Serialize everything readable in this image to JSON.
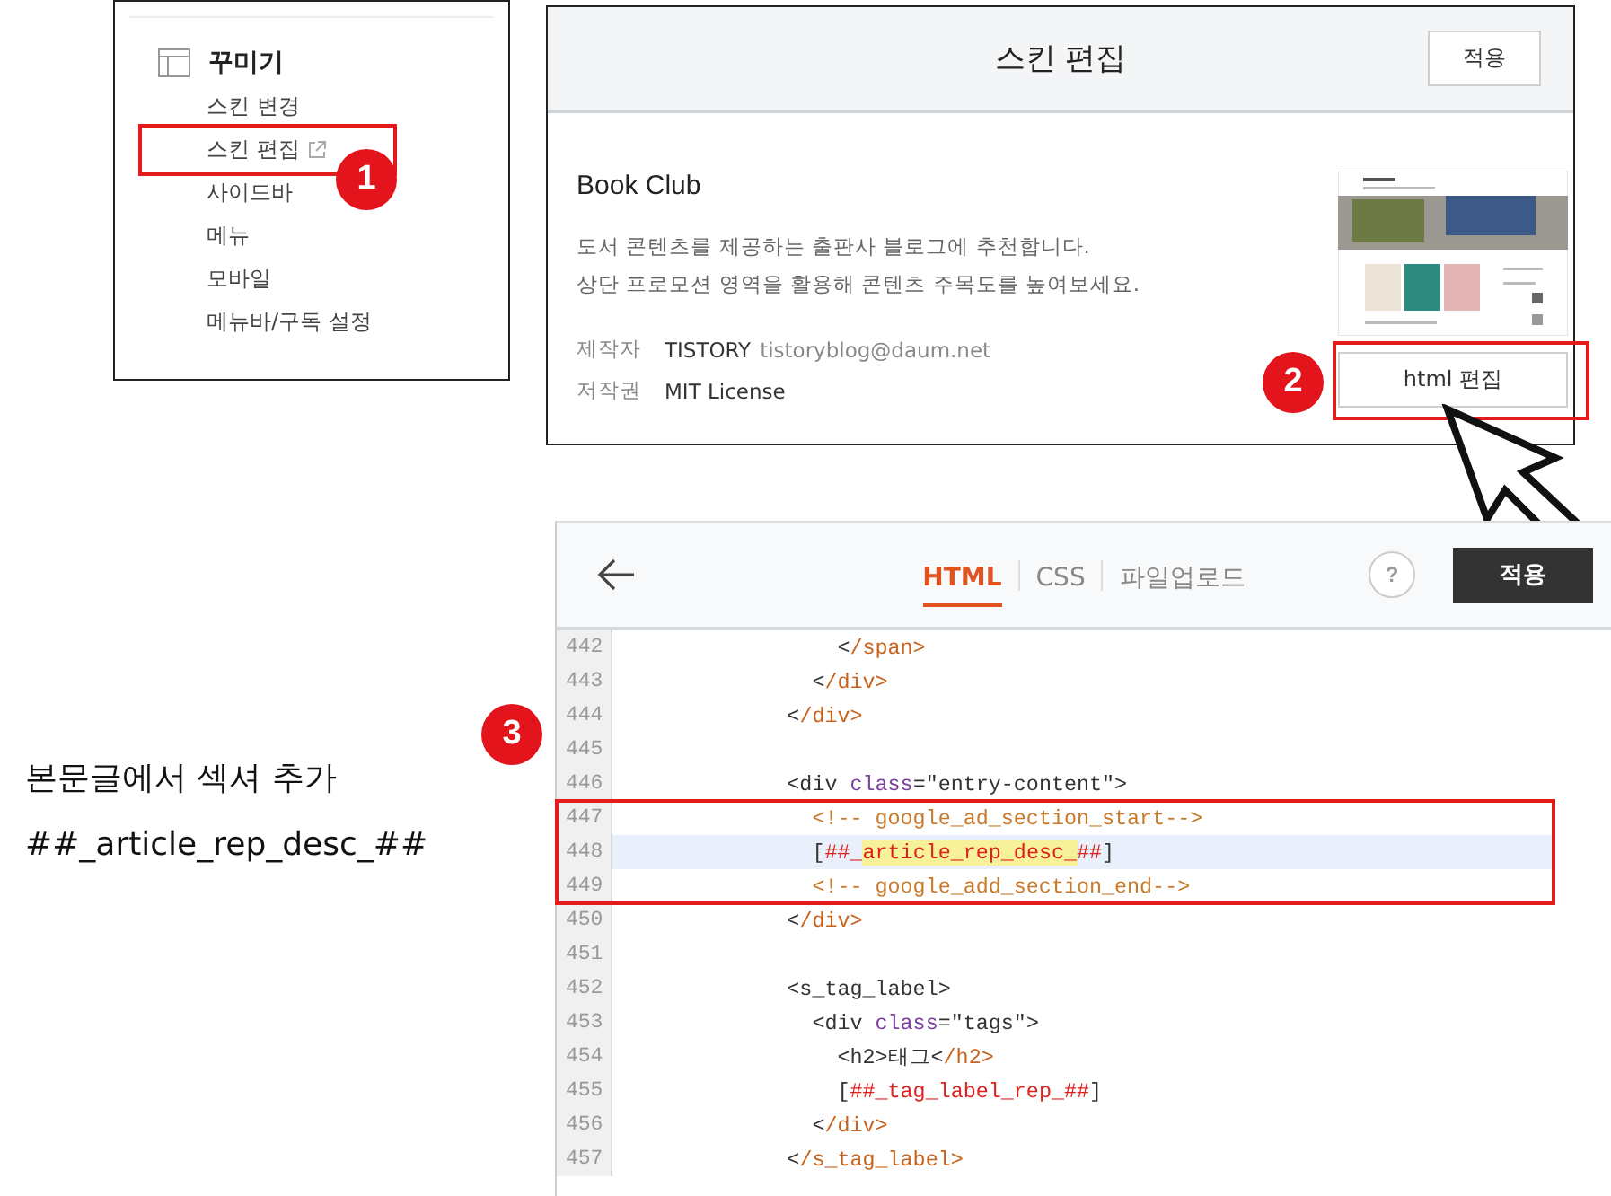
{
  "sidebar_menu": {
    "title": "꾸미기",
    "badge": "1",
    "items": [
      {
        "label": "스킨 변경",
        "external": false,
        "highlighted": false
      },
      {
        "label": "스킨 편집",
        "external": true,
        "highlighted": true
      },
      {
        "label": "사이드바",
        "external": false,
        "highlighted": false
      },
      {
        "label": "메뉴",
        "external": false,
        "highlighted": false
      },
      {
        "label": "모바일",
        "external": false,
        "highlighted": false
      },
      {
        "label": "메뉴바/구독 설정",
        "external": false,
        "highlighted": false
      }
    ]
  },
  "skin_dialog": {
    "title": "스킨 편집",
    "apply_button": "적용",
    "name": "Book Club",
    "description": [
      "도서 콘텐츠를 제공하는 출판사 블로그에 추천합니다.",
      "상단 프로모션 영역을 활용해 콘텐츠 주목도를 높여보세요."
    ],
    "meta": [
      {
        "label": "제작자",
        "value": "TISTORY",
        "detail": "tistoryblog@daum.net"
      },
      {
        "label": "저작권",
        "value": "MIT License"
      }
    ],
    "html_edit_button": {
      "label": "html 편집",
      "highlighted": true,
      "badge": "2"
    }
  },
  "caption": {
    "lines": [
      "본문글에서 섹셔 추가",
      "##_article_rep_desc_##"
    ]
  },
  "editor": {
    "tabs": [
      {
        "label": "HTML",
        "selected": true
      },
      {
        "label": "CSS",
        "selected": false
      },
      {
        "label": "파일업로드",
        "selected": false
      }
    ],
    "help_button": "?",
    "apply_button": "적용",
    "badge": "3",
    "lines": [
      {
        "number": "442",
        "selected": false,
        "highlighted": false,
        "tokens": [
          {
            "kind": "punct",
            "text": "                <"
          },
          {
            "kind": "close",
            "text": "/span>"
          }
        ]
      },
      {
        "number": "443",
        "selected": false,
        "highlighted": false,
        "tokens": [
          {
            "kind": "punct",
            "text": "              <"
          },
          {
            "kind": "close",
            "text": "/div>"
          }
        ]
      },
      {
        "number": "444",
        "selected": false,
        "highlighted": false,
        "tokens": [
          {
            "kind": "punct",
            "text": "            <"
          },
          {
            "kind": "close",
            "text": "/div>"
          }
        ]
      },
      {
        "number": "445",
        "selected": false,
        "highlighted": false
      },
      {
        "number": "446",
        "selected": false,
        "highlighted": false,
        "tokens": [
          {
            "kind": "punct",
            "text": "            <div "
          },
          {
            "kind": "attr",
            "text": "class"
          },
          {
            "kind": "punct",
            "text": "="
          },
          {
            "kind": "string",
            "text": "\"entry-content\""
          },
          {
            "kind": "punct",
            "text": ">"
          }
        ]
      },
      {
        "number": "447",
        "selected": false,
        "highlighted": true,
        "tokens": [
          {
            "kind": "comment",
            "text": "              <!-- google_ad_section_start-->"
          }
        ]
      },
      {
        "number": "448",
        "selected": true,
        "highlighted": true,
        "tokens": [
          {
            "kind": "punct",
            "text": "              ["
          },
          {
            "kind": "template",
            "text": "##_"
          },
          {
            "kind": "template",
            "text": "article_rep_desc_",
            "marked": true
          },
          {
            "kind": "template",
            "text": "##"
          },
          {
            "kind": "punct",
            "text": "]"
          }
        ]
      },
      {
        "number": "449",
        "selected": false,
        "highlighted": true,
        "tokens": [
          {
            "kind": "comment",
            "text": "              <!-- google_add_section_end-->"
          }
        ]
      },
      {
        "number": "450",
        "selected": false,
        "highlighted": false,
        "tokens": [
          {
            "kind": "punct",
            "text": "            <"
          },
          {
            "kind": "close",
            "text": "/div>"
          }
        ]
      },
      {
        "number": "451",
        "selected": false,
        "highlighted": false
      },
      {
        "number": "452",
        "selected": false,
        "highlighted": false,
        "tokens": [
          {
            "kind": "punct",
            "text": "            <s_tag_label>"
          }
        ]
      },
      {
        "number": "453",
        "selected": false,
        "highlighted": false,
        "tokens": [
          {
            "kind": "punct",
            "text": "              <div "
          },
          {
            "kind": "attr",
            "text": "class"
          },
          {
            "kind": "punct",
            "text": "="
          },
          {
            "kind": "string",
            "text": "\"tags\""
          },
          {
            "kind": "punct",
            "text": ">"
          }
        ]
      },
      {
        "number": "454",
        "selected": false,
        "highlighted": false,
        "tokens": [
          {
            "kind": "punct",
            "text": "                <h2>태그<"
          },
          {
            "kind": "close",
            "text": "/h2>"
          }
        ]
      },
      {
        "number": "455",
        "selected": false,
        "highlighted": false,
        "tokens": [
          {
            "kind": "punct",
            "text": "                ["
          },
          {
            "kind": "template",
            "text": "##_tag_label_rep_##"
          },
          {
            "kind": "punct",
            "text": "]"
          }
        ]
      },
      {
        "number": "456",
        "selected": false,
        "highlighted": false,
        "tokens": [
          {
            "kind": "punct",
            "text": "              <"
          },
          {
            "kind": "close",
            "text": "/div>"
          }
        ]
      },
      {
        "number": "457",
        "selected": false,
        "highlighted": false,
        "tokens": [
          {
            "kind": "punct",
            "text": "            <"
          },
          {
            "kind": "close",
            "text": "/s_tag_label>"
          }
        ]
      }
    ]
  }
}
